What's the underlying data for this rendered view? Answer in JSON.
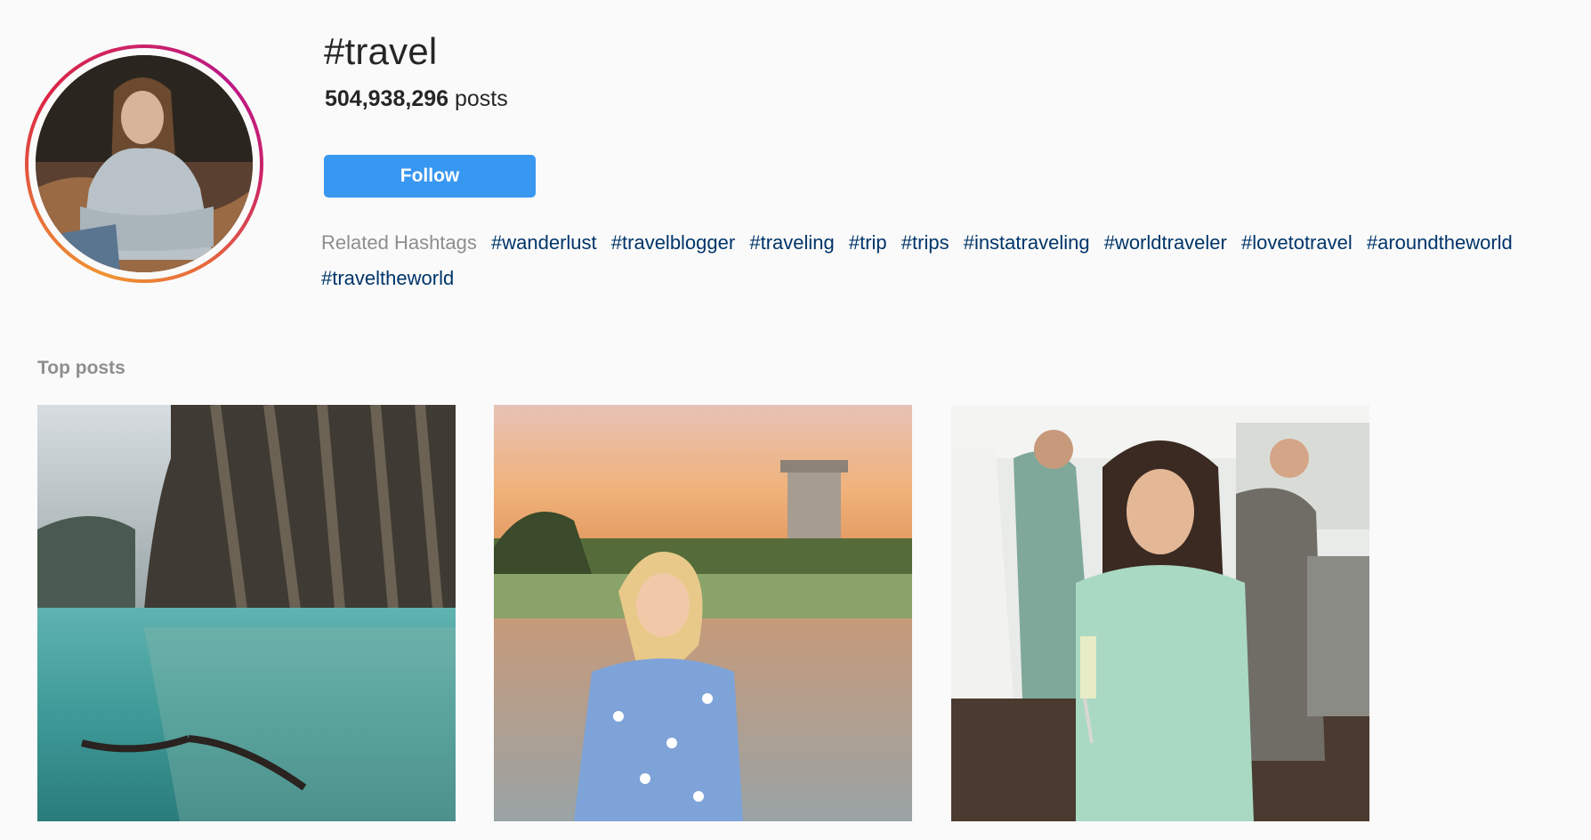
{
  "header": {
    "hashtag": "#travel",
    "post_count": "504,938,296",
    "post_count_suffix": "posts",
    "follow_label": "Follow"
  },
  "related": {
    "label": "Related Hashtags",
    "tags": [
      "#wanderlust",
      "#travelblogger",
      "#traveling",
      "#trip",
      "#trips",
      "#instatraveling",
      "#worldtraveler",
      "#lovetotravel",
      "#aroundtheworld",
      "#traveltheworld"
    ]
  },
  "top_posts": {
    "title": "Top posts",
    "posts": [
      {
        "icon": "swimmers-lagoon-photo"
      },
      {
        "icon": "woman-sunset-lake-photo"
      },
      {
        "icon": "woman-party-champagne-photo"
      }
    ]
  },
  "colors": {
    "follow_bg": "#3897f0",
    "hashtag_link": "#003569",
    "muted_text": "#8e8e8e",
    "background": "#fafafa"
  }
}
